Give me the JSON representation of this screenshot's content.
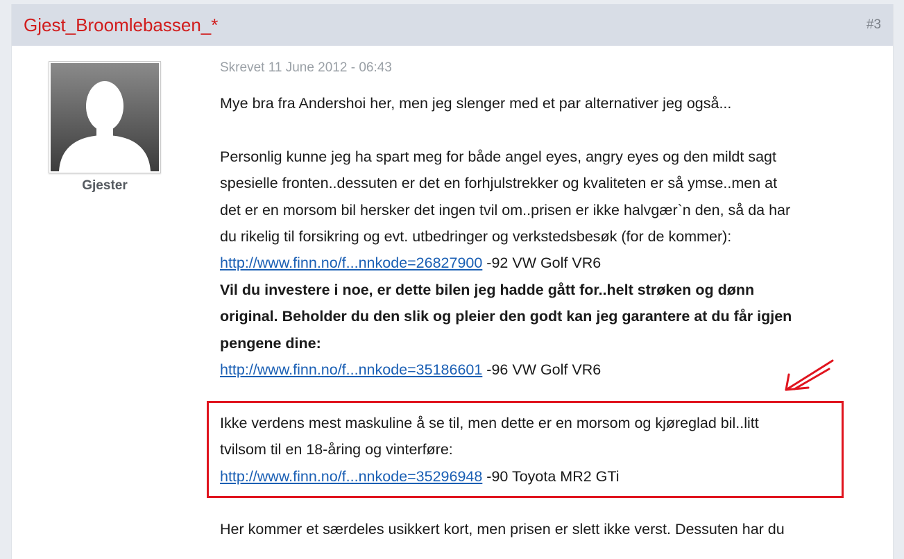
{
  "post": {
    "author": "Gjest_Broomlebassen_*",
    "number": "#3",
    "user_group": "Gjester",
    "date": "Skrevet 11 June 2012 - 06:43",
    "intro": "Mye bra fra Andershoi her, men jeg slenger med et par alternativer jeg også...",
    "paragraph1_line1": "Personlig kunne jeg ha spart meg for både angel eyes, angry eyes og den mildt sagt",
    "paragraph1_line2": "spesielle fronten..dessuten er det en forhjulstrekker og kvaliteten er så ymse..men at",
    "paragraph1_line3": "det er en morsom bil hersker det ingen tvil om..prisen er ikke halvgær`n den, så da har",
    "paragraph1_line4": "du rikelig til forsikring og evt. utbedringer og verkstedsbesøk (for de kommer):",
    "link1": "http://www.finn.no/f...nnkode=26827900",
    "link1_suffix": " -92 VW Golf VR6",
    "bold_line1": "Vil du investere i noe, er dette bilen jeg hadde gått for..helt strøken og dønn",
    "bold_line2": "original. Beholder du den slik og pleier den godt kan jeg garantere at du får igjen",
    "bold_line3": "pengene dine:",
    "link2": "http://www.finn.no/f...nnkode=35186601",
    "link2_suffix": " -96 VW Golf VR6",
    "paragraph2_line1": "Ikke verdens mest maskuline å se til, men dette er en morsom og kjøreglad bil..litt",
    "paragraph2_line2": "tvilsom til en 18-åring og vinterføre:",
    "link3": "http://www.finn.no/f...nnkode=35296948",
    "link3_suffix": " -90 Toyota MR2 GTi",
    "cut_line": "Her kommer et særdeles usikkert kort, men prisen er slett ikke verst. Dessuten har du"
  },
  "colors": {
    "author": "#d11c1c",
    "header_bg": "#d8dde6",
    "link": "#1a5fb4",
    "highlight": "#e0141e"
  }
}
